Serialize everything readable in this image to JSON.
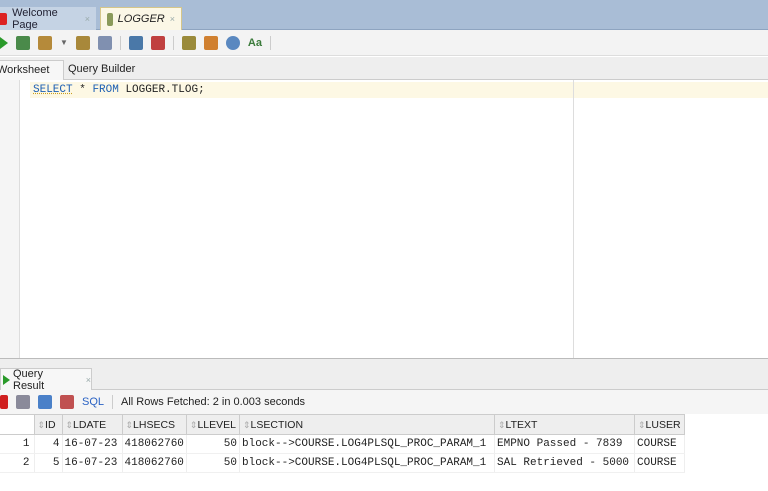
{
  "tabs": [
    {
      "label": "Welcome Page",
      "close": "×"
    },
    {
      "label": "LOGGER",
      "close": "×"
    }
  ],
  "toolbar_icons": [
    "run-statement-icon",
    "run-script-icon",
    "commit-icon",
    "dropdown-icon",
    "rollback-icon",
    "explain-plan-icon",
    "autotrace-icon",
    "sql-tuning-icon",
    "unshared-sql-icon",
    "clear-icon",
    "history-icon",
    "format-icon"
  ],
  "subtabs": {
    "worksheet": "Worksheet",
    "query_builder": "Query Builder"
  },
  "editor": {
    "kw1": "SELECT",
    "star": "*",
    "kw2": "FROM",
    "rest": "LOGGER.TLOG;"
  },
  "result": {
    "tab_label": "Query Result",
    "close": "×",
    "sql_label": "SQL",
    "status": "All Rows Fetched: 2 in 0.003 seconds"
  },
  "table": {
    "columns": [
      "ID",
      "LDATE",
      "LHSECS",
      "LLEVEL",
      "LSECTION",
      "LTEXT",
      "LUSER"
    ],
    "rows": [
      {
        "n": "1",
        "cells": [
          "4",
          "16-07-23",
          "418062760",
          "50",
          "block-->COURSE.LOG4PLSQL_PROC_PARAM_1",
          "EMPNO Passed - 7839",
          "COURSE"
        ]
      },
      {
        "n": "2",
        "cells": [
          "5",
          "16-07-23",
          "418062760",
          "50",
          "block-->COURSE.LOG4PLSQL_PROC_PARAM_1",
          "SAL Retrieved - 5000",
          "COURSE"
        ]
      }
    ]
  }
}
